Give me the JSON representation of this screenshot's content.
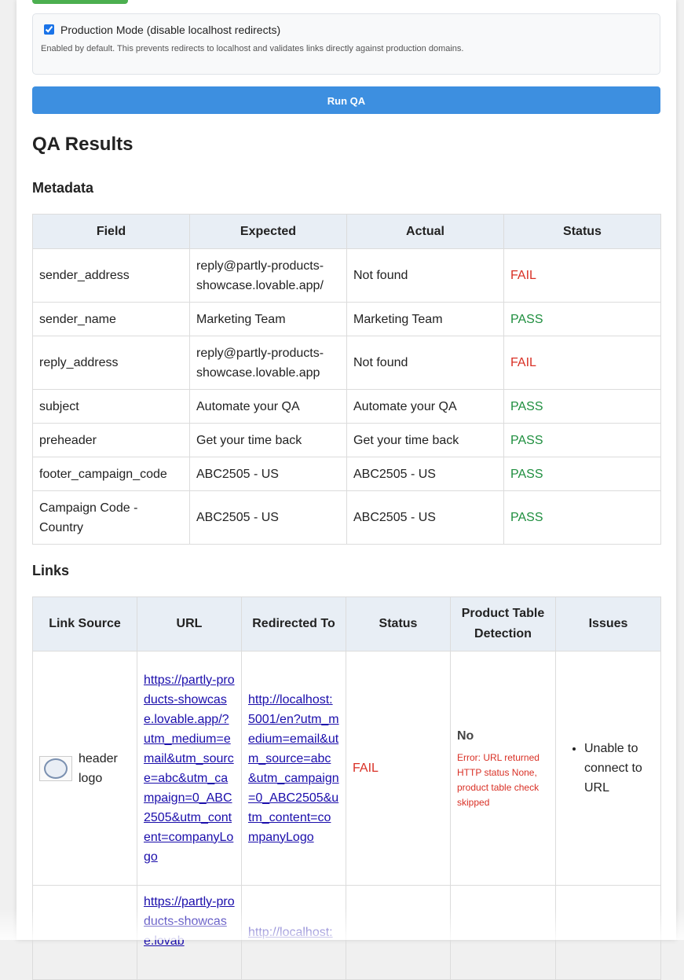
{
  "production_mode": {
    "checked": true,
    "label": "Production Mode (disable localhost redirects)",
    "note": "Enabled by default. This prevents redirects to localhost and validates links directly against production domains."
  },
  "run_button": {
    "label": "Run QA"
  },
  "results": {
    "title": "QA Results",
    "metadata": {
      "title": "Metadata",
      "headers": [
        "Field",
        "Expected",
        "Actual",
        "Status"
      ],
      "rows": [
        {
          "field": "sender_address",
          "expected": "reply@partly-products-showcase.lovable.app/",
          "actual": "Not found",
          "status": "FAIL"
        },
        {
          "field": "sender_name",
          "expected": "Marketing Team",
          "actual": "Marketing Team",
          "status": "PASS"
        },
        {
          "field": "reply_address",
          "expected": "reply@partly-products-showcase.lovable.app",
          "actual": "Not found",
          "status": "FAIL"
        },
        {
          "field": "subject",
          "expected": "Automate your QA",
          "actual": "Automate your QA",
          "status": "PASS"
        },
        {
          "field": "preheader",
          "expected": "Get your time back",
          "actual": "Get your time back",
          "status": "PASS"
        },
        {
          "field": "footer_campaign_code",
          "expected": "ABC2505 - US",
          "actual": "ABC2505 - US",
          "status": "PASS"
        },
        {
          "field": "Campaign Code - Country",
          "expected": "ABC2505 - US",
          "actual": "ABC2505 - US",
          "status": "PASS"
        }
      ]
    },
    "links": {
      "title": "Links",
      "headers": [
        "Link Source",
        "URL",
        "Redirected To",
        "Status",
        "Product Table Detection",
        "Issues"
      ],
      "rows": [
        {
          "source": "header logo",
          "url": "https://partly-products-showcase.lovable.app/?utm_medium=email&utm_source=abc&utm_campaign=0_ABC2505&utm_content=companyLogo",
          "redirected": "http://localhost:5001/en?utm_medium=email&utm_source=abc&utm_campaign=0_ABC2505&utm_content=companyLogo",
          "status": "FAIL",
          "ptd": "No",
          "ptd_error": "Error: URL returned HTTP status None, product table check skipped",
          "issues": [
            "Unable to connect to URL"
          ]
        },
        {
          "source": "",
          "url": "https://partly-products-showcase.lovab",
          "redirected": "http://localhost:",
          "status": "",
          "ptd": "",
          "ptd_error": "",
          "issues": []
        }
      ]
    }
  },
  "colors": {
    "pass": "#1e8e3e",
    "fail": "#d93025",
    "run_button": "#3d8fe0",
    "header_bg": "#e8eef5"
  }
}
